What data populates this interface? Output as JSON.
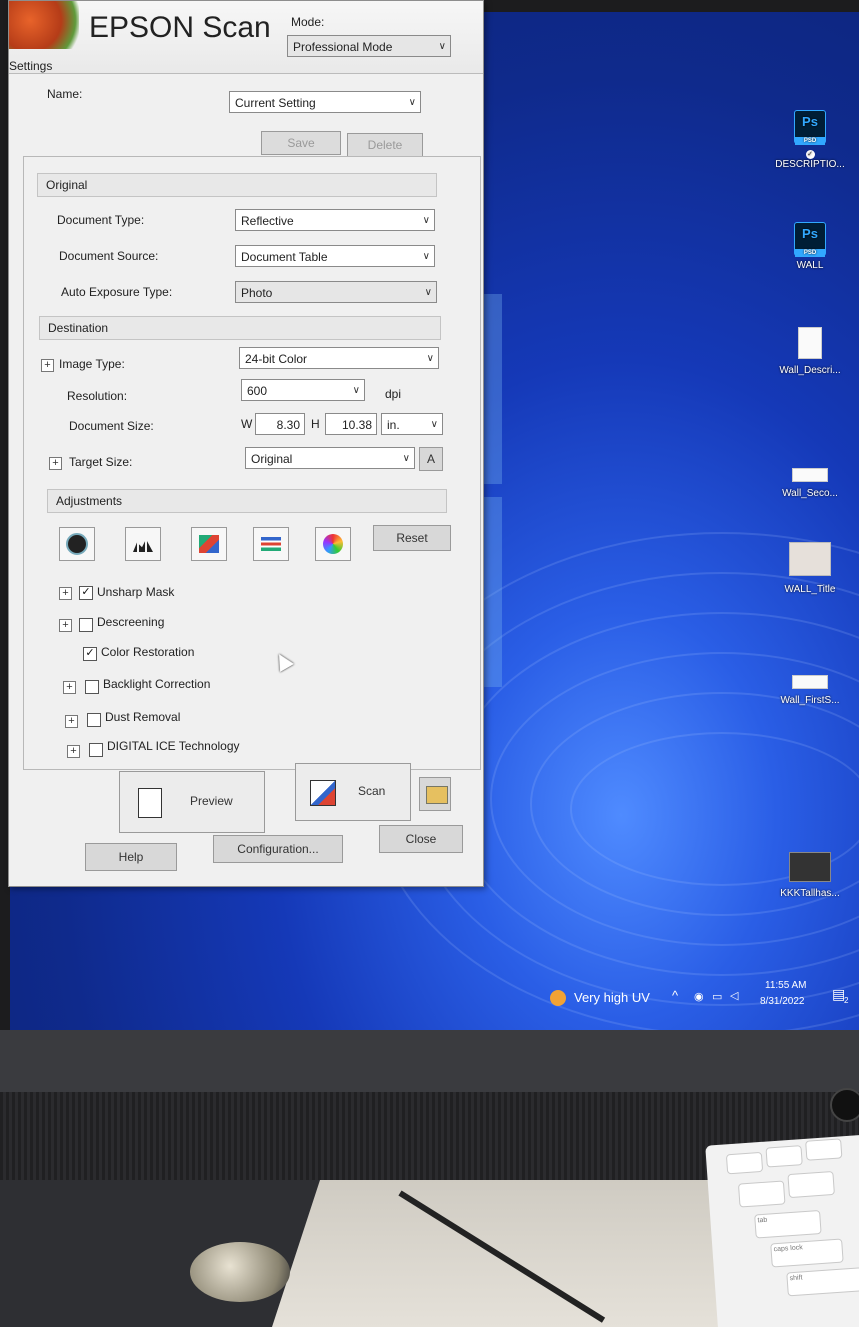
{
  "window": {
    "title": "EPSON Scan",
    "mode_label": "Mode:",
    "mode_value": "Professional Mode"
  },
  "settings": {
    "group_label": "Settings",
    "name_label": "Name:",
    "name_value": "Current Setting",
    "save_label": "Save",
    "delete_label": "Delete"
  },
  "original": {
    "header": "Original",
    "document_type_label": "Document Type:",
    "document_type_value": "Reflective",
    "document_source_label": "Document Source:",
    "document_source_value": "Document Table",
    "auto_exposure_label": "Auto Exposure Type:",
    "auto_exposure_value": "Photo"
  },
  "destination": {
    "header": "Destination",
    "image_type_label": "Image Type:",
    "image_type_value": "24-bit Color",
    "resolution_label": "Resolution:",
    "resolution_value": "600",
    "resolution_unit": "dpi",
    "document_size_label": "Document Size:",
    "w_label": "W",
    "w_value": "8.30",
    "h_label": "H",
    "h_value": "10.38",
    "size_unit": "in.",
    "target_size_label": "Target Size:",
    "target_size_value": "Original"
  },
  "adjustments": {
    "header": "Adjustments",
    "reset_label": "Reset",
    "tools": [
      "auto-exposure-icon",
      "histogram-icon",
      "tone-curve-icon",
      "image-adjustment-icon",
      "color-palette-icon"
    ],
    "options": [
      {
        "label": "Unsharp Mask",
        "checked": true,
        "expandable": true
      },
      {
        "label": "Descreening",
        "checked": false,
        "expandable": true
      },
      {
        "label": "Color Restoration",
        "checked": true,
        "expandable": false
      },
      {
        "label": "Backlight Correction",
        "checked": false,
        "expandable": true
      },
      {
        "label": "Dust Removal",
        "checked": false,
        "expandable": true
      },
      {
        "label": "DIGITAL ICE Technology",
        "checked": false,
        "expandable": true
      }
    ]
  },
  "footer": {
    "preview_label": "Preview",
    "scan_label": "Scan",
    "help_label": "Help",
    "configuration_label": "Configuration...",
    "close_label": "Close"
  },
  "desktop_icons": [
    {
      "label": "DESCRIPTIO...",
      "kind": "psd"
    },
    {
      "label": "WALL",
      "kind": "psd"
    },
    {
      "label": "Wall_Descri...",
      "kind": "file"
    },
    {
      "label": "Wall_Seco...",
      "kind": "wide"
    },
    {
      "label": "WALL_Title",
      "kind": "thumb"
    },
    {
      "label": "Wall_FirstS...",
      "kind": "wide"
    },
    {
      "label": "KKKTallhas...",
      "kind": "dark"
    }
  ],
  "taskbar": {
    "weather_text": "Very high UV",
    "time": "11:55 AM",
    "date": "8/31/2022",
    "notification_count": "2"
  },
  "keyboard_keys": [
    "caps lock",
    "shift",
    "tab"
  ],
  "colors": {
    "desktop_blue": "#1539b8",
    "window_bg": "#f0f0f0",
    "ps_blue": "#31a8ff"
  }
}
